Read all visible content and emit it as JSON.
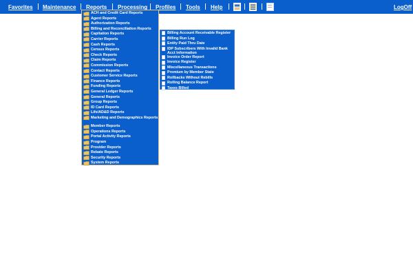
{
  "menubar": {
    "items": [
      {
        "label": "Favorites"
      },
      {
        "label": "Maintenance"
      },
      {
        "label": "Reports"
      },
      {
        "label": "Processing"
      },
      {
        "label": "Profiles"
      },
      {
        "label": "Tools"
      },
      {
        "label": "Help"
      }
    ],
    "logoff": "LogOff"
  },
  "reports_menu": {
    "items": [
      {
        "label": "ACH and Credit Card Reports",
        "tall": false
      },
      {
        "label": "Agent Reports",
        "tall": false
      },
      {
        "label": "Authorization Reports",
        "tall": false
      },
      {
        "label": "Billing and Reconciliation Reports",
        "tall": false
      },
      {
        "label": "Capitation Reports",
        "tall": false
      },
      {
        "label": "Carrier Reports",
        "tall": false
      },
      {
        "label": "Cash Reports",
        "tall": false
      },
      {
        "label": "Census Reports",
        "tall": false
      },
      {
        "label": "Check Reports",
        "tall": false
      },
      {
        "label": "Claim Reports",
        "tall": false
      },
      {
        "label": "Commission Reports",
        "tall": false
      },
      {
        "label": "Contact Reports",
        "tall": false
      },
      {
        "label": "Customer Service Reports",
        "tall": false
      },
      {
        "label": "Finance Reports",
        "tall": false
      },
      {
        "label": "Funding Reports",
        "tall": false
      },
      {
        "label": "General Ledger Reports",
        "tall": false
      },
      {
        "label": "General Reports",
        "tall": false
      },
      {
        "label": "Group Reports",
        "tall": false
      },
      {
        "label": "ID Card Reports",
        "tall": false
      },
      {
        "label": "Life/AD&D Reports",
        "tall": false
      },
      {
        "label": "Marketing and Demographics Reports",
        "tall": true
      },
      {
        "label": "Member Reports",
        "tall": false
      },
      {
        "label": "Operations Reports",
        "tall": false
      },
      {
        "label": "Portal Activity Reports",
        "tall": false
      },
      {
        "label": "Program",
        "tall": false
      },
      {
        "label": "Provider Reports",
        "tall": false
      },
      {
        "label": "Rebate Reports",
        "tall": false
      },
      {
        "label": "Security Reports",
        "tall": false
      },
      {
        "label": "System Reports",
        "tall": false
      }
    ]
  },
  "billing_submenu": {
    "items": [
      {
        "label": "Billing Account Receivable Register",
        "tall": false
      },
      {
        "label": "Billing Run Log",
        "tall": false
      },
      {
        "label": "Entity Paid Thru Date",
        "tall": false
      },
      {
        "label": "IDP Subscribers With Invalid Bank Acct Information",
        "tall": true
      },
      {
        "label": "Invoice Order Report",
        "tall": false
      },
      {
        "label": "Invoice Register",
        "tall": false
      },
      {
        "label": "Miscellaneous Transactions",
        "tall": false
      },
      {
        "label": "Premium by Member State",
        "tall": false
      },
      {
        "label": "Rollbacks Without Rebills",
        "tall": false
      },
      {
        "label": "Rolling Balance Report",
        "tall": false
      },
      {
        "label": "Taxes Billed",
        "tall": false
      }
    ]
  },
  "colors": {
    "bar": "#0a5fcd",
    "border_accent": "#e8c98a",
    "folder": "#e9c46a"
  },
  "icons": [
    "folder-icon",
    "document-icon",
    "toolbar-window-icon",
    "toolbar-list-icon",
    "toolbar-page-icon"
  ]
}
